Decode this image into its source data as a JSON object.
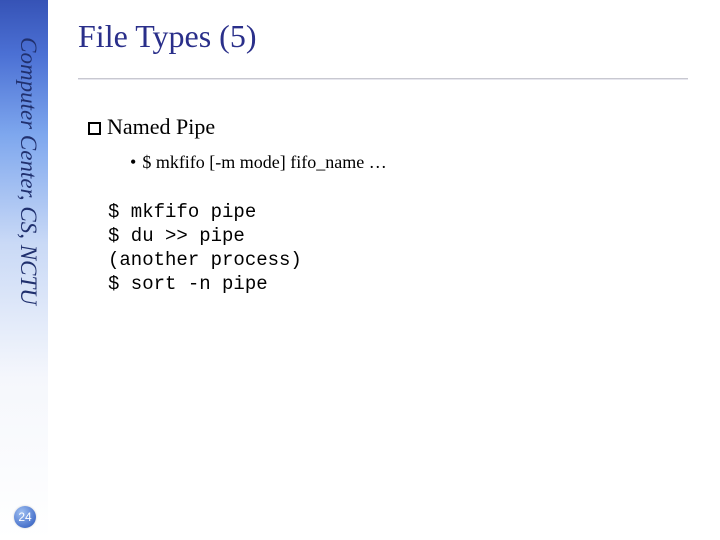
{
  "sidebar": {
    "label": "Computer Center, CS, NCTU"
  },
  "title": "File Types (5)",
  "bullets": {
    "level1": "Named Pipe",
    "level2": "$ mkfifo [-m mode] fifo_name …"
  },
  "code": {
    "l1": "$ mkfifo pipe",
    "l2": "$ du >> pipe",
    "l3": "(another process)",
    "l4": "$ sort -n pipe"
  },
  "page_number": "24"
}
